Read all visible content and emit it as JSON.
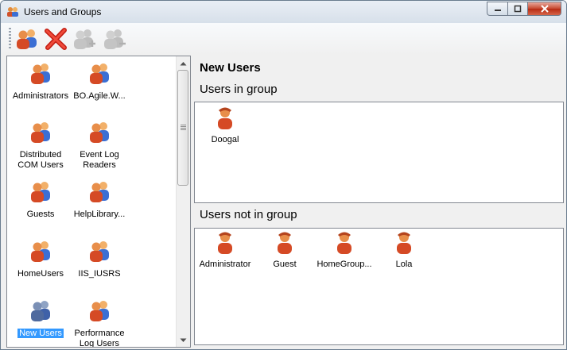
{
  "window": {
    "title": "Users and Groups"
  },
  "toolbar": {
    "buttons": [
      {
        "name": "add-group-button",
        "icon": "group-add-icon",
        "enabled": true
      },
      {
        "name": "delete-group-button",
        "icon": "red-x-delete-icon",
        "enabled": true
      },
      {
        "name": "add-user-to-group-button",
        "icon": "user-add-icon",
        "enabled": false
      },
      {
        "name": "remove-user-from-group-button",
        "icon": "user-remove-icon",
        "enabled": false
      }
    ]
  },
  "groups": [
    {
      "label": "Administrators",
      "selected": false
    },
    {
      "label": "BO.Agile.W...",
      "selected": false
    },
    {
      "label": "Distributed COM Users",
      "selected": false
    },
    {
      "label": "Event Log Readers",
      "selected": false
    },
    {
      "label": "Guests",
      "selected": false
    },
    {
      "label": "HelpLibrary...",
      "selected": false
    },
    {
      "label": "HomeUsers",
      "selected": false
    },
    {
      "label": "IIS_IUSRS",
      "selected": false
    },
    {
      "label": "New Users",
      "selected": true
    },
    {
      "label": "Performance Log Users",
      "selected": false
    }
  ],
  "detail": {
    "group_name": "New Users",
    "in_group_heading": "Users in group",
    "not_in_group_heading": "Users not in group",
    "users_in_group": [
      "Doogal"
    ],
    "users_not_in_group": [
      "Administrator",
      "Guest",
      "HomeGroup...",
      "Lola"
    ]
  },
  "colors": {
    "selection": "#3399ff",
    "user_icon": "#e06a3c",
    "group_icon_secondary": "#3b6fd4"
  }
}
